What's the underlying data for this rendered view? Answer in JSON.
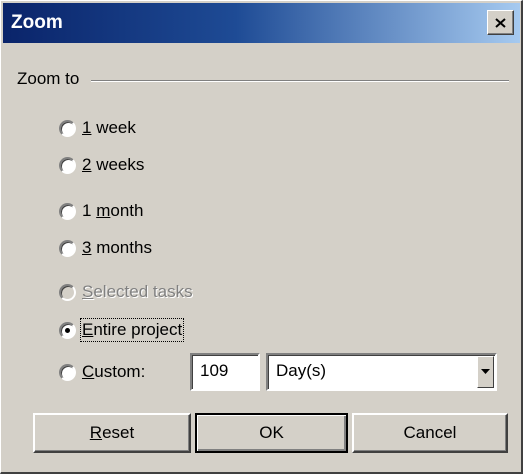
{
  "window": {
    "title": "Zoom"
  },
  "group": {
    "label": "Zoom to"
  },
  "options": [
    {
      "pre": "",
      "key": "1",
      "post": " week",
      "checked": false,
      "disabled": false
    },
    {
      "pre": "",
      "key": "2",
      "post": " weeks",
      "checked": false,
      "disabled": false
    },
    {
      "pre": "1 ",
      "key": "m",
      "post": "onth",
      "checked": false,
      "disabled": false
    },
    {
      "pre": "",
      "key": "3",
      "post": " months",
      "checked": false,
      "disabled": false
    },
    {
      "pre": "",
      "key": "S",
      "post": "elected tasks",
      "checked": false,
      "disabled": true
    },
    {
      "pre": "",
      "key": "E",
      "post": "ntire project",
      "checked": true,
      "disabled": false
    },
    {
      "pre": "",
      "key": "C",
      "post": "ustom:",
      "checked": false,
      "disabled": false
    }
  ],
  "custom": {
    "value": "109",
    "unit": "Day(s)"
  },
  "buttons": {
    "reset": {
      "key": "R",
      "post": "eset"
    },
    "ok": "OK",
    "cancel": "Cancel"
  }
}
